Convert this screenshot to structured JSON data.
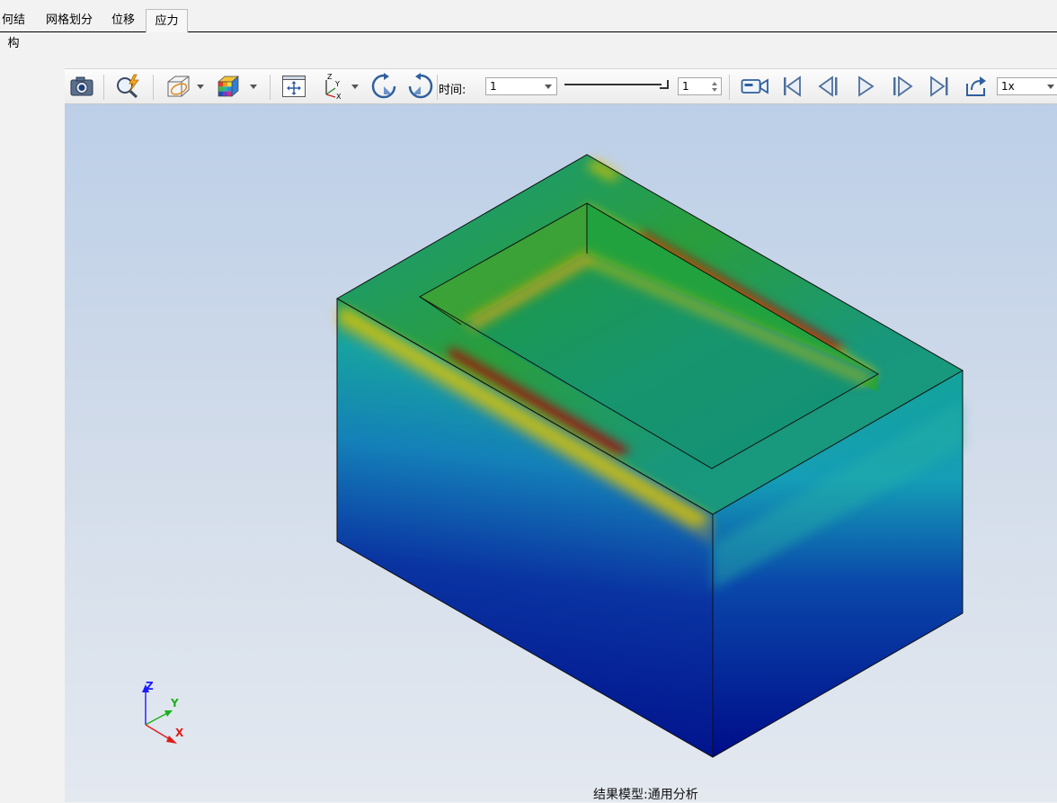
{
  "tabs": [
    {
      "label": "何结构",
      "active": false
    },
    {
      "label": "网格划分",
      "active": false
    },
    {
      "label": "位移",
      "active": false
    },
    {
      "label": "应力",
      "active": true
    }
  ],
  "toolbar": {
    "time_label": "时间:",
    "time_value": "1",
    "frame_value": "1",
    "speed_value": "1x",
    "icons": [
      "camera-icon",
      "probe-icon",
      "section-view-icon",
      "color-cube-icon",
      "fit-view-icon",
      "axis-orient-icon",
      "rotate-cw-icon",
      "rotate-ccw-icon",
      "record-icon",
      "first-frame-icon",
      "prev-frame-icon",
      "play-icon",
      "next-frame-icon",
      "last-frame-icon",
      "export-icon"
    ]
  },
  "triad": {
    "z": "Z",
    "y": "Y",
    "x": "X"
  },
  "footer": {
    "model_label": "结果模型:通用分析"
  },
  "colors": {
    "accent": "#2f5f9e",
    "stress_high": "#b80000",
    "stress_low": "#00108c"
  }
}
